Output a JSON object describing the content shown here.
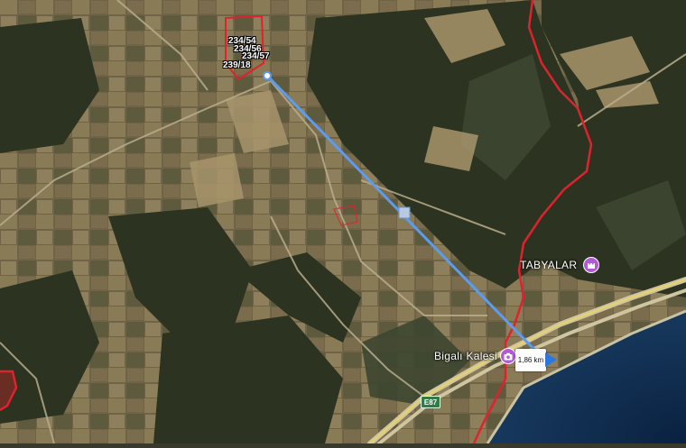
{
  "map": {
    "type": "satellite",
    "parcel_labels": [
      "234/54",
      "234/56",
      "234/57",
      "239/18"
    ],
    "places": [
      {
        "name": "TABYALAR",
        "icon": "castle-icon"
      },
      {
        "name": "Bigalı Kalesi",
        "icon": "camera-icon"
      }
    ],
    "measurement": {
      "distance": "1,86 km",
      "line_color": "#5b9cf0"
    },
    "road_shield": "E87",
    "colors": {
      "boundary": "#e0222e",
      "sea": "#0e2a47",
      "poi_pin": "#b15ad6",
      "motorway": "#e7d36a"
    }
  }
}
